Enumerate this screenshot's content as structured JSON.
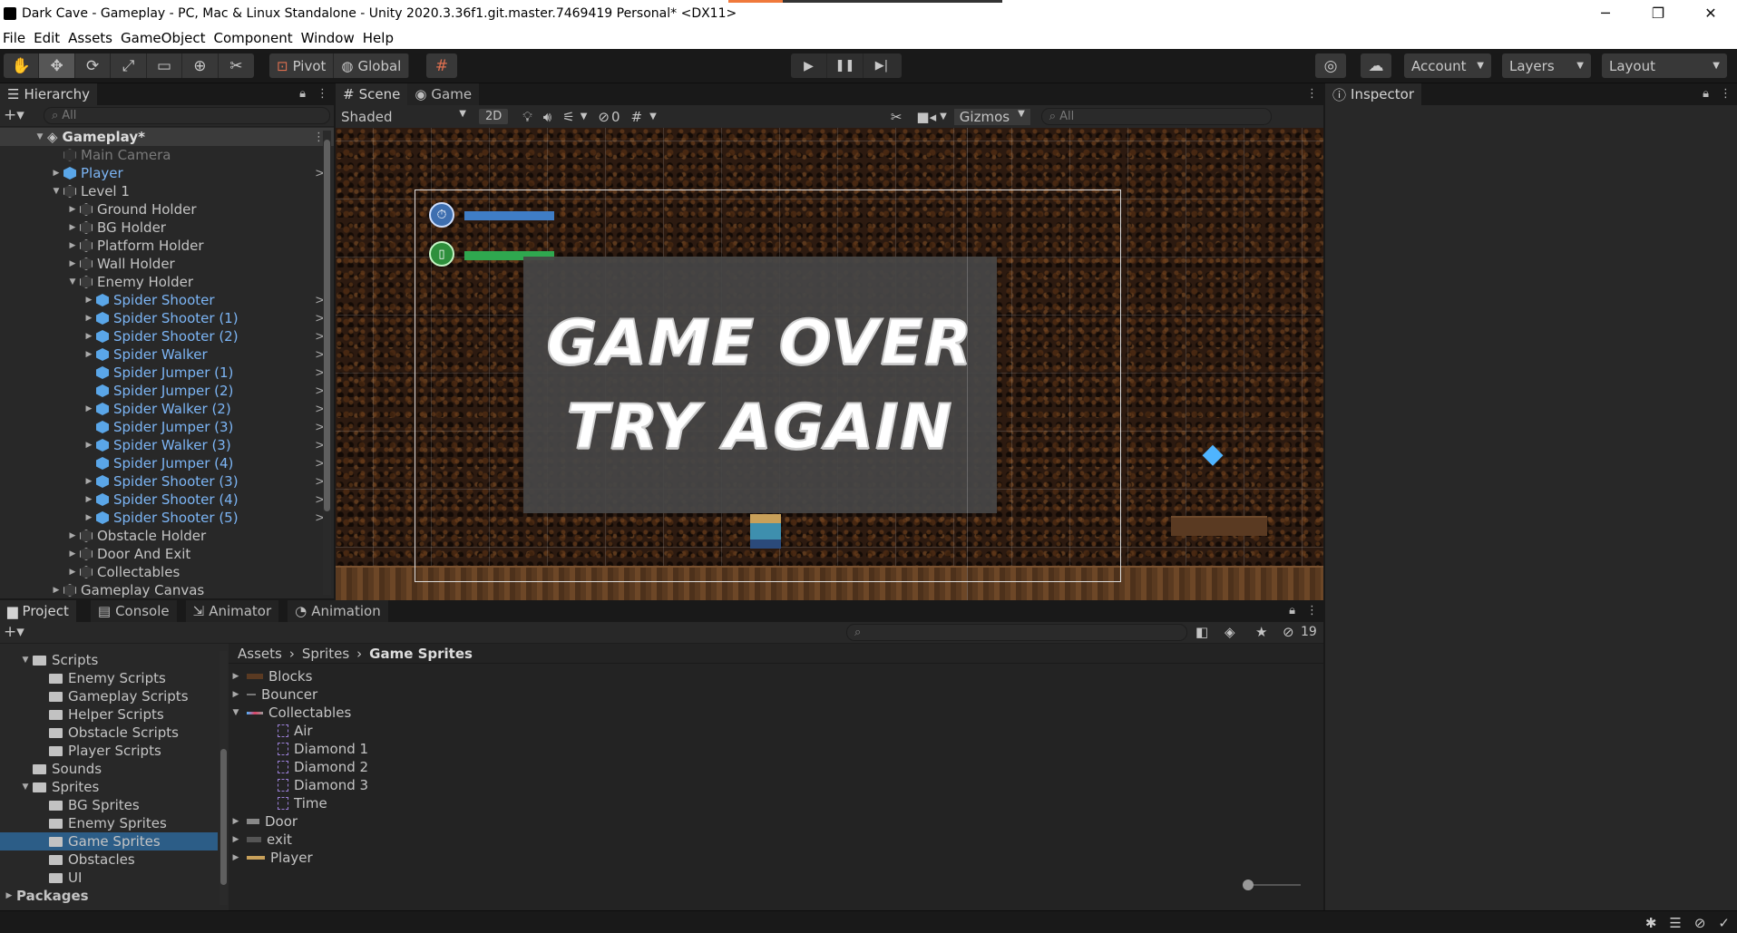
{
  "window": {
    "title": "Dark Cave - Gameplay - PC, Mac & Linux Standalone - Unity 2020.3.36f1.git.master.7469419 Personal* <DX11>",
    "minimize": "─",
    "maximize": "❐",
    "close": "✕"
  },
  "menu": [
    "File",
    "Edit",
    "Assets",
    "GameObject",
    "Component",
    "Window",
    "Help"
  ],
  "toolbar": {
    "pivot_label": "Pivot",
    "global_label": "Global",
    "account_label": "Account",
    "layers_label": "Layers",
    "layout_label": "Layout"
  },
  "hierarchy": {
    "tab_label": "Hierarchy",
    "search_placeholder": "All",
    "scene_name": "Gameplay*",
    "items": [
      {
        "label": "Main Camera",
        "indent": 1,
        "arrow": "",
        "style": "dim",
        "icon": "gameobject"
      },
      {
        "label": "Player",
        "indent": 1,
        "arrow": "▶",
        "style": "blue",
        "icon": "prefab",
        "more": ">"
      },
      {
        "label": "Level 1",
        "indent": 1,
        "arrow": "▼",
        "style": "",
        "icon": "gameobject"
      },
      {
        "label": "Ground Holder",
        "indent": 2,
        "arrow": "▶",
        "style": "",
        "icon": "gameobject"
      },
      {
        "label": "BG Holder",
        "indent": 2,
        "arrow": "▶",
        "style": "",
        "icon": "gameobject"
      },
      {
        "label": "Platform Holder",
        "indent": 2,
        "arrow": "▶",
        "style": "",
        "icon": "gameobject"
      },
      {
        "label": "Wall Holder",
        "indent": 2,
        "arrow": "▶",
        "style": "",
        "icon": "gameobject"
      },
      {
        "label": "Enemy Holder",
        "indent": 2,
        "arrow": "▼",
        "style": "",
        "icon": "gameobject"
      },
      {
        "label": "Spider Shooter",
        "indent": 3,
        "arrow": "▶",
        "style": "blue",
        "icon": "prefab",
        "more": ">"
      },
      {
        "label": "Spider Shooter (1)",
        "indent": 3,
        "arrow": "▶",
        "style": "blue",
        "icon": "prefab",
        "more": ">"
      },
      {
        "label": "Spider Shooter (2)",
        "indent": 3,
        "arrow": "▶",
        "style": "blue",
        "icon": "prefab",
        "more": ">"
      },
      {
        "label": "Spider Walker",
        "indent": 3,
        "arrow": "▶",
        "style": "blue",
        "icon": "prefab",
        "more": ">"
      },
      {
        "label": "Spider Jumper (1)",
        "indent": 3,
        "arrow": "",
        "style": "blue",
        "icon": "prefab",
        "more": ">"
      },
      {
        "label": "Spider Jumper (2)",
        "indent": 3,
        "arrow": "",
        "style": "blue",
        "icon": "prefab",
        "more": ">"
      },
      {
        "label": "Spider Walker (2)",
        "indent": 3,
        "arrow": "▶",
        "style": "blue",
        "icon": "prefab",
        "more": ">"
      },
      {
        "label": "Spider Jumper (3)",
        "indent": 3,
        "arrow": "",
        "style": "blue",
        "icon": "prefab",
        "more": ">"
      },
      {
        "label": "Spider Walker (3)",
        "indent": 3,
        "arrow": "▶",
        "style": "blue",
        "icon": "prefab",
        "more": ">"
      },
      {
        "label": "Spider Jumper (4)",
        "indent": 3,
        "arrow": "",
        "style": "blue",
        "icon": "prefab",
        "more": ">"
      },
      {
        "label": "Spider Shooter (3)",
        "indent": 3,
        "arrow": "▶",
        "style": "blue",
        "icon": "prefab",
        "more": ">"
      },
      {
        "label": "Spider Shooter (4)",
        "indent": 3,
        "arrow": "▶",
        "style": "blue",
        "icon": "prefab",
        "more": ">"
      },
      {
        "label": "Spider Shooter (5)",
        "indent": 3,
        "arrow": "▶",
        "style": "blue",
        "icon": "prefab",
        "more": ">"
      },
      {
        "label": "Obstacle Holder",
        "indent": 2,
        "arrow": "▶",
        "style": "",
        "icon": "gameobject"
      },
      {
        "label": "Door And Exit",
        "indent": 2,
        "arrow": "▶",
        "style": "",
        "icon": "gameobject"
      },
      {
        "label": "Collectables",
        "indent": 2,
        "arrow": "▶",
        "style": "",
        "icon": "gameobject"
      },
      {
        "label": "Gameplay Canvas",
        "indent": 1,
        "arrow": "▶",
        "style": "",
        "icon": "gameobject"
      }
    ]
  },
  "scene_view": {
    "tabs": [
      "Scene",
      "Game"
    ],
    "shading_mode": "Shaded",
    "mode_2d": "2D",
    "hidden_count": "0",
    "gizmos_label": "Gizmos",
    "search_placeholder": "All",
    "game_over_line1": "GAME OVER",
    "game_over_line2": "TRY AGAIN"
  },
  "inspector": {
    "tab_label": "Inspector"
  },
  "bottom_tabs": [
    "Project",
    "Console",
    "Animator",
    "Animation"
  ],
  "project": {
    "hidden_count": "19",
    "folders": [
      {
        "label": "Scripts",
        "indent": 1,
        "arrow": "▼"
      },
      {
        "label": "Enemy Scripts",
        "indent": 2,
        "arrow": ""
      },
      {
        "label": "Gameplay Scripts",
        "indent": 2,
        "arrow": ""
      },
      {
        "label": "Helper Scripts",
        "indent": 2,
        "arrow": ""
      },
      {
        "label": "Obstacle Scripts",
        "indent": 2,
        "arrow": ""
      },
      {
        "label": "Player Scripts",
        "indent": 2,
        "arrow": ""
      },
      {
        "label": "Sounds",
        "indent": 1,
        "arrow": ""
      },
      {
        "label": "Sprites",
        "indent": 1,
        "arrow": "▼"
      },
      {
        "label": "BG Sprites",
        "indent": 2,
        "arrow": ""
      },
      {
        "label": "Enemy Sprites",
        "indent": 2,
        "arrow": ""
      },
      {
        "label": "Game Sprites",
        "indent": 2,
        "arrow": "",
        "selected": true
      },
      {
        "label": "Obstacles",
        "indent": 2,
        "arrow": ""
      },
      {
        "label": "UI",
        "indent": 2,
        "arrow": ""
      },
      {
        "label": "Packages",
        "indent": 0,
        "arrow": "▶",
        "bold": true
      }
    ],
    "breadcrumb": [
      "Assets",
      "Sprites",
      "Game Sprites"
    ],
    "assets": [
      {
        "label": "Blocks",
        "indent": 0,
        "arrow": "▶",
        "thumb": "blocks"
      },
      {
        "label": "Bouncer",
        "indent": 0,
        "arrow": "▶",
        "thumb": "bouncer"
      },
      {
        "label": "Collectables",
        "indent": 0,
        "arrow": "▼",
        "thumb": "collectables"
      },
      {
        "label": "Air",
        "indent": 1,
        "arrow": "",
        "thumb": "sprite"
      },
      {
        "label": "Diamond 1",
        "indent": 1,
        "arrow": "",
        "thumb": "sprite"
      },
      {
        "label": "Diamond 2",
        "indent": 1,
        "arrow": "",
        "thumb": "sprite"
      },
      {
        "label": "Diamond 3",
        "indent": 1,
        "arrow": "",
        "thumb": "sprite"
      },
      {
        "label": "Time",
        "indent": 1,
        "arrow": "",
        "thumb": "sprite"
      },
      {
        "label": "Door",
        "indent": 0,
        "arrow": "▶",
        "thumb": "door"
      },
      {
        "label": "exit",
        "indent": 0,
        "arrow": "▶",
        "thumb": "exit"
      },
      {
        "label": "Player",
        "indent": 0,
        "arrow": "▶",
        "thumb": "player"
      }
    ]
  }
}
